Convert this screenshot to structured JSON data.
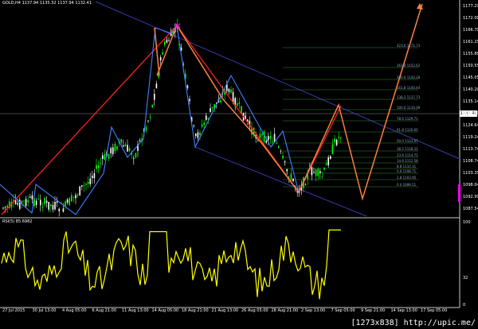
{
  "header": {
    "title": "GOLD,H4 1137.94 1135.32 1137.94 1132.41"
  },
  "rsi": {
    "title": "RSI(5) 85.6982"
  },
  "watermark": "[1273x838] http://upic.me/",
  "current_price": "1132.41",
  "price_axis": [
    "1177.29",
    "1172.00",
    "1166.70",
    "1161.25",
    "1155.80",
    "1150.55",
    "1145.05",
    "1140.20",
    "1135.14",
    "1129.60",
    "1124.64",
    "1119.24",
    "1113.74",
    "1108.74",
    "1103.35",
    "1098.04",
    "1092.99",
    "1087.54"
  ],
  "rsi_axis": [
    "100",
    "32",
    "0"
  ],
  "time_axis": [
    "27 Jul 2015",
    "30 Jul 13:00",
    "4 Aug 05:00",
    "6 Aug 21:00",
    "11 Aug 13:00",
    "14 Aug 05:00",
    "18 Aug 21:00",
    "21 Aug 13:00",
    "26 Aug 05:00",
    "28 Aug 21:00",
    "2 Sep 13:00",
    "7 Sep 05:00",
    "9 Sep 21:00",
    "14 Sep 13:00",
    "17 Sep 05:00"
  ],
  "fibo_levels": [
    "423.6 1171.73",
    "261.8 1152.62",
    "200.0 1144.28",
    "161.8 1140.44",
    "138.2 1137.73",
    "100.0 1134.09",
    "78.6 1129.71",
    "61.8 1126.65",
    "50.0 1122.67",
    "38.2 1118.22",
    "23.6 1114.75",
    "14.6 1112.58",
    "8.8 1110.31",
    "5.6 1108.71",
    "2.8 1103.95",
    "0.0 1099.51"
  ],
  "colors": {
    "candle_up": "#00ff00",
    "candle_down": "#ffffff",
    "red_line": "#ff2020",
    "orange_line": "#ff8040",
    "blue_line": "#4080ff",
    "rsi_line": "#ffff00",
    "fibo": "#2e8b2e",
    "channel": "#3a3aa8",
    "marker": "#ff00ff"
  }
}
